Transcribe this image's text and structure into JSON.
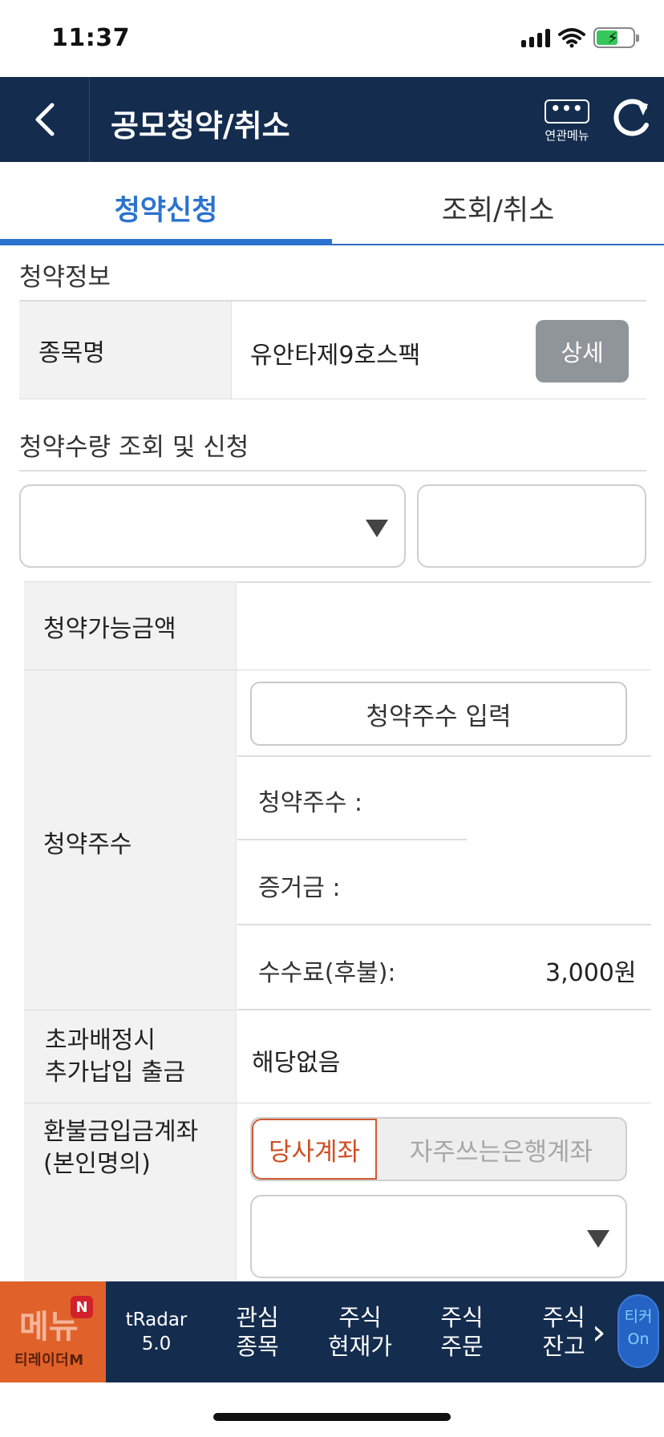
{
  "status_bar": {
    "time": "11:37"
  },
  "header": {
    "back_icon": "chevron-left-icon",
    "title": "공모청약/취소",
    "related_menu_icon": "•••",
    "related_menu_label": "연관메뉴",
    "refresh_icon": "refresh-icon"
  },
  "tabs": [
    {
      "label": "청약신청",
      "active": true
    },
    {
      "label": "조회/취소",
      "active": false
    }
  ],
  "subscription_info": {
    "section_title": "청약정보",
    "item_label": "종목명",
    "item_value": "유안타제9호스팩",
    "detail_button": "상세"
  },
  "quantity": {
    "section_title": "청약수량 조회 및 신청",
    "available_amount_label": "청약가능금액",
    "shares_label": "청약주수",
    "enter_shares_button": "청약주수 입력",
    "shares_field_label": "청약주수 :",
    "deposit_label": "증거금 :",
    "fee_label": "수수료(후불):",
    "fee_value": "3,000원",
    "excess_label_line1": "초과배정시",
    "excess_label_line2": "추가납입 출금",
    "excess_value": "해당없음",
    "refund_label_line1": "환불금입금계좌",
    "refund_label_line2": "(본인명의)",
    "refund_option_1": "당사계좌",
    "refund_option_2": "자주쓰는은행계좌"
  },
  "bottom_nav": {
    "menu_label": "메뉴",
    "menu_badge": "N",
    "menu_brand": "티레이더M",
    "items": [
      {
        "line1": "tRadar",
        "line2": "5.0"
      },
      {
        "line1": "관심",
        "line2": "종목"
      },
      {
        "line1": "주식",
        "line2": "현재가"
      },
      {
        "line1": "주식",
        "line2": "주문"
      },
      {
        "line1": "주식",
        "line2": "잔고"
      }
    ],
    "ticker_line1": "티커",
    "ticker_line2": "On"
  },
  "colors": {
    "header_bg": "#142c4e",
    "tab_active": "#2b73cf",
    "accent_orange": "#e0622a",
    "selected_option": "#cf4e22"
  }
}
